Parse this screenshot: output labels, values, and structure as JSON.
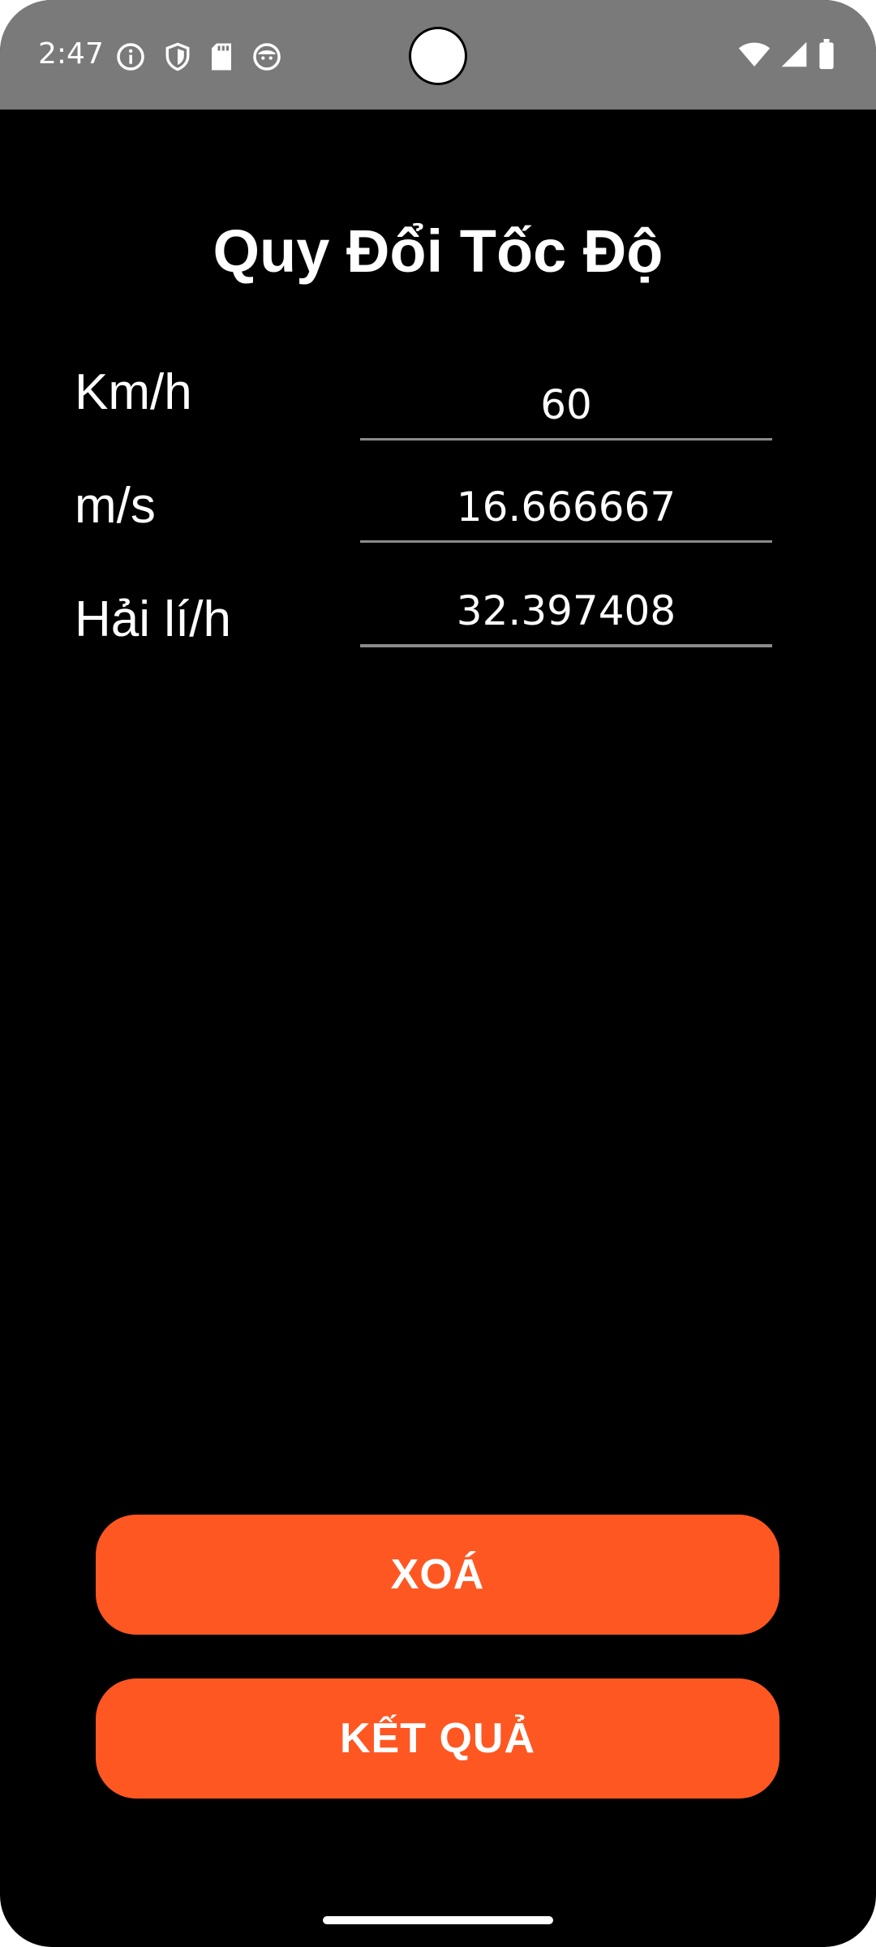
{
  "status_bar": {
    "time": "2:47",
    "left_icons": [
      "info-icon",
      "shield-icon",
      "sd-card-icon",
      "face-icon"
    ],
    "right_icons": [
      "wifi-icon",
      "cellular-signal-icon",
      "battery-icon"
    ]
  },
  "title": "Quy Đổi Tốc Độ",
  "rows": [
    {
      "label": "Km/h",
      "value": "60"
    },
    {
      "label": "m/s",
      "value": "16.666667"
    },
    {
      "label": "Hải lí/h",
      "value": "32.397408"
    }
  ],
  "buttons": {
    "clear_label": "XOÁ",
    "result_label": "KẾT QUẢ"
  },
  "colors": {
    "accent": "#ff5722",
    "background": "#000000",
    "status_bar": "#7a7a7a"
  }
}
